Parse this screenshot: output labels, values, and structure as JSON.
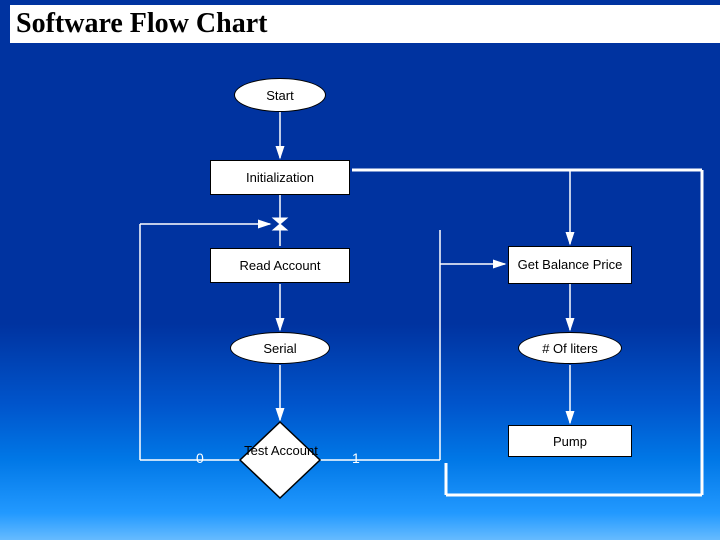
{
  "title": "Software Flow Chart",
  "nodes": {
    "start": "Start",
    "init": "Initialization",
    "read_account": "Read Account",
    "serial": "Serial",
    "test_account": "Test Account",
    "get_balance": "Get Balance Price",
    "of_liters": "# Of liters",
    "pump": "Pump"
  },
  "edges": {
    "label0": "0",
    "label1": "1"
  }
}
